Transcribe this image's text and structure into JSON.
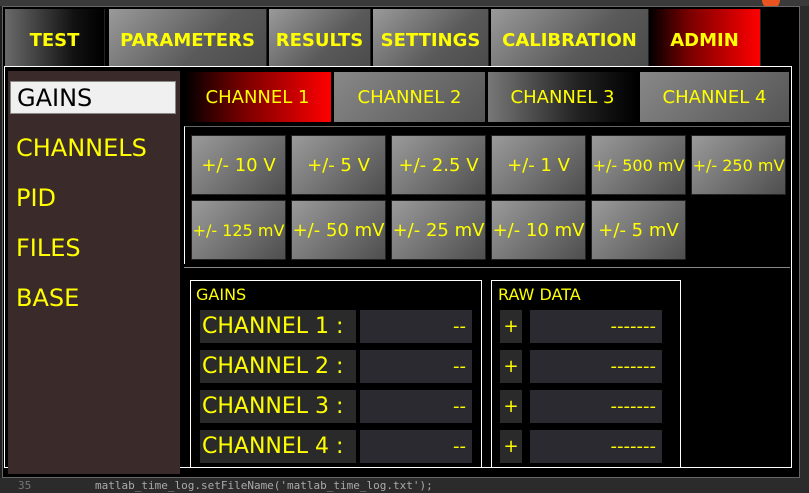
{
  "top_tabs": [
    {
      "label": "TEST"
    },
    {
      "label": "PARAMETERS"
    },
    {
      "label": "RESULTS"
    },
    {
      "label": "SETTINGS"
    },
    {
      "label": "CALIBRATION"
    },
    {
      "label": "ADMIN",
      "active": true
    }
  ],
  "side_menu": [
    {
      "label": "GAINS",
      "active": true
    },
    {
      "label": "CHANNELS"
    },
    {
      "label": "PID"
    },
    {
      "label": "FILES"
    },
    {
      "label": "BASE"
    }
  ],
  "channel_tabs": [
    {
      "label": "CHANNEL 1",
      "active": true
    },
    {
      "label": "CHANNEL 2"
    },
    {
      "label": "CHANNEL 3"
    },
    {
      "label": "CHANNEL 4"
    }
  ],
  "gain_buttons": [
    "+/- 10 V",
    "+/- 5 V",
    "+/- 2.5 V",
    "+/- 1 V",
    "+/- 500 mV",
    "+/- 250 mV",
    "+/- 125 mV",
    "+/- 50 mV",
    "+/- 25 mV",
    "+/- 10 mV",
    "+/- 5 mV"
  ],
  "gains_group": {
    "title": "GAINS",
    "rows": [
      {
        "label": "CHANNEL 1   :",
        "value": "--"
      },
      {
        "label": "CHANNEL 2   :",
        "value": "--"
      },
      {
        "label": "CHANNEL 3   :",
        "value": "--"
      },
      {
        "label": "CHANNEL 4   :",
        "value": "--"
      }
    ]
  },
  "raw_group": {
    "title": "RAW DATA",
    "rows": [
      {
        "sign": "+",
        "value": "-------"
      },
      {
        "sign": "+",
        "value": "-------"
      },
      {
        "sign": "+",
        "value": "-------"
      },
      {
        "sign": "+",
        "value": "-------"
      }
    ]
  },
  "editor": {
    "line_number": "35",
    "code": "matlab_time_log.setFileName('matlab_time_log.txt');"
  },
  "colors": {
    "label_yellow": "#ffff00",
    "active_red": "#ff0000",
    "side_panel": "#3a2a2a"
  }
}
